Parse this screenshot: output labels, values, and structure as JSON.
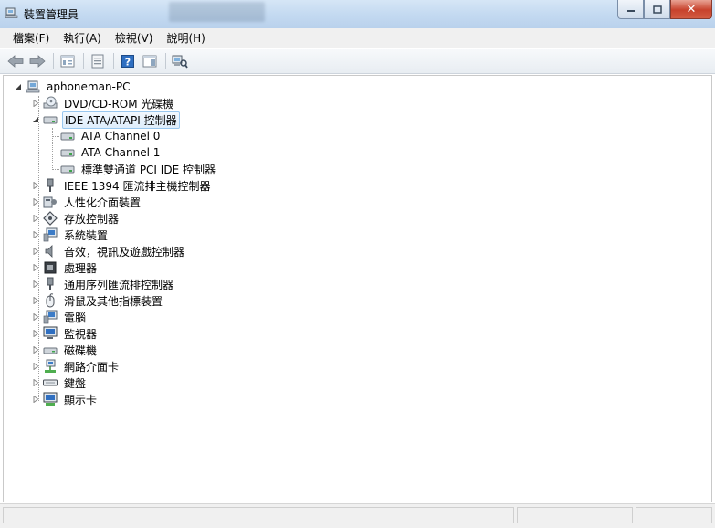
{
  "window": {
    "title": "裝置管理員"
  },
  "menu": [
    "檔案(F)",
    "執行(A)",
    "檢視(V)",
    "說明(H)"
  ],
  "toolbar_icons": [
    "back-arrow-icon",
    "forward-arrow-icon",
    "tree-view-icon",
    "properties-icon",
    "help-icon",
    "show-hide-console-icon",
    "scan-hardware-icon"
  ],
  "tree": {
    "root": "aphoneman-PC",
    "items": [
      {
        "label": "DVD/CD-ROM 光碟機",
        "icon": "dvd-drive-icon"
      },
      {
        "label": "IDE ATA/ATAPI 控制器",
        "icon": "ide-controller-icon",
        "expanded": true,
        "selected": true,
        "children": [
          "ATA Channel 0",
          "ATA Channel 1",
          "標準雙通道 PCI IDE 控制器"
        ]
      },
      {
        "label": "IEEE 1394 匯流排主機控制器",
        "icon": "ieee1394-icon"
      },
      {
        "label": "人性化介面裝置",
        "icon": "hid-icon"
      },
      {
        "label": "存放控制器",
        "icon": "storage-controller-icon"
      },
      {
        "label": "系統裝置",
        "icon": "system-devices-icon"
      },
      {
        "label": "音效，視訊及遊戲控制器",
        "icon": "sound-icon"
      },
      {
        "label": "處理器",
        "icon": "processor-icon"
      },
      {
        "label": "通用序列匯流排控制器",
        "icon": "usb-icon"
      },
      {
        "label": "滑鼠及其他指標裝置",
        "icon": "mouse-icon"
      },
      {
        "label": "電腦",
        "icon": "computer-icon"
      },
      {
        "label": "監視器",
        "icon": "monitor-icon"
      },
      {
        "label": "磁碟機",
        "icon": "disk-drive-icon"
      },
      {
        "label": "網路介面卡",
        "icon": "network-adapter-icon"
      },
      {
        "label": "鍵盤",
        "icon": "keyboard-icon"
      },
      {
        "label": "顯示卡",
        "icon": "display-adapter-icon"
      }
    ]
  }
}
